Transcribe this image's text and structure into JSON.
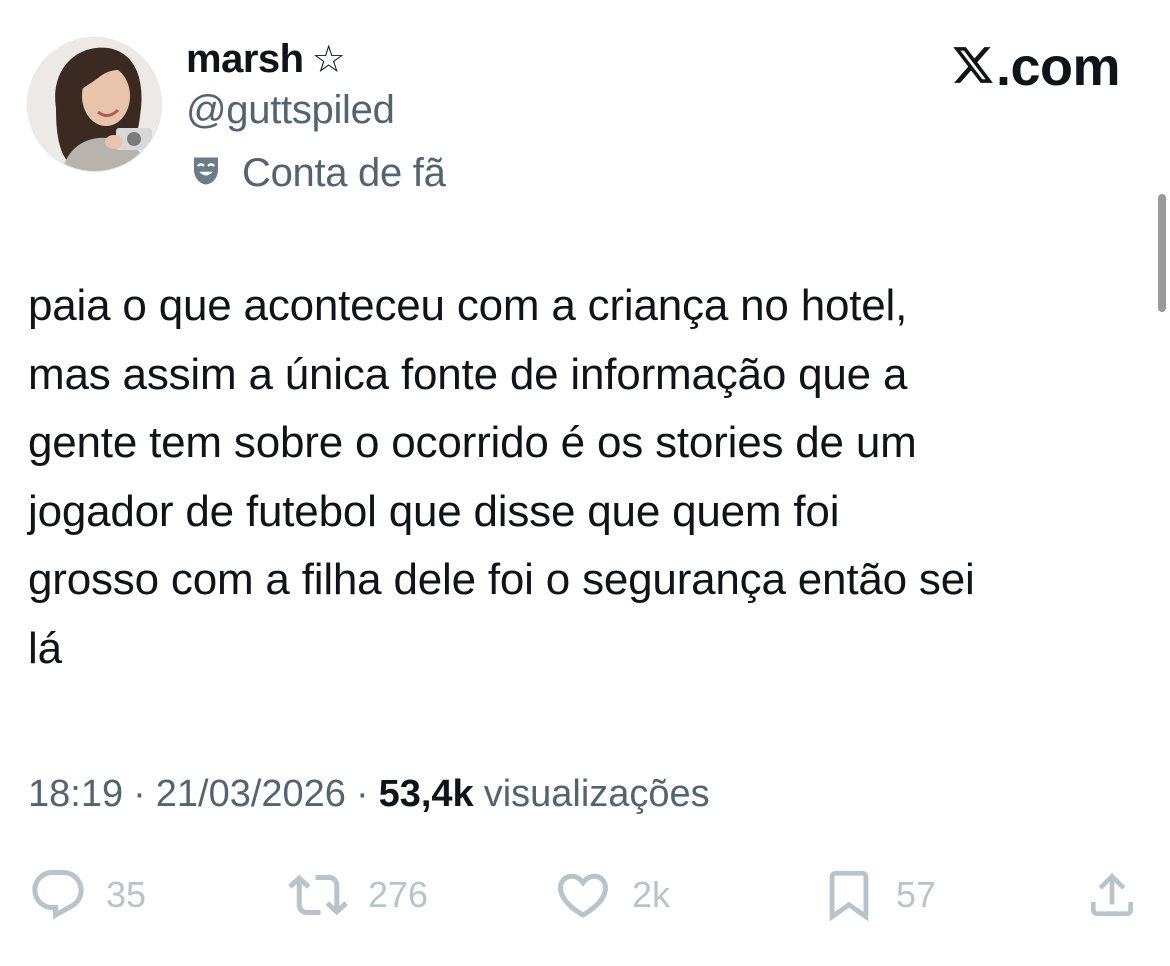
{
  "author": {
    "display_name": "marsh",
    "name_suffix_icon": "star-outline-icon",
    "handle": "@guttspiled",
    "affiliation_icon": "theater-mask-icon",
    "affiliation_label": "Conta de fã",
    "avatar": "profile-photo"
  },
  "brand": {
    "logo": "x-logo",
    "suffix": ".com"
  },
  "tweet": {
    "lines": [
      "paia o que aconteceu com a criança no hotel,",
      "mas assim a única fonte de informação que a",
      "gente tem sobre o ocorrido é os stories de um",
      "jogador de futebol que disse que quem foi",
      "grosso com a filha dele foi o segurança então sei",
      "lá"
    ]
  },
  "meta": {
    "time": "18:19",
    "separator": "·",
    "date": "21/03/2026",
    "views_count": "53,4k",
    "views_label": "visualizações"
  },
  "actions": {
    "replies": {
      "icon": "reply-icon",
      "count": "35"
    },
    "reposts": {
      "icon": "repost-icon",
      "count": "276"
    },
    "likes": {
      "icon": "heart-icon",
      "count": "2k"
    },
    "bookmarks": {
      "icon": "bookmark-icon",
      "count": "57"
    },
    "share": {
      "icon": "share-icon"
    }
  },
  "colors": {
    "text_primary": "#0f1419",
    "text_secondary": "#536471",
    "action_faded": "#b8c4cc",
    "background": "#ffffff"
  }
}
